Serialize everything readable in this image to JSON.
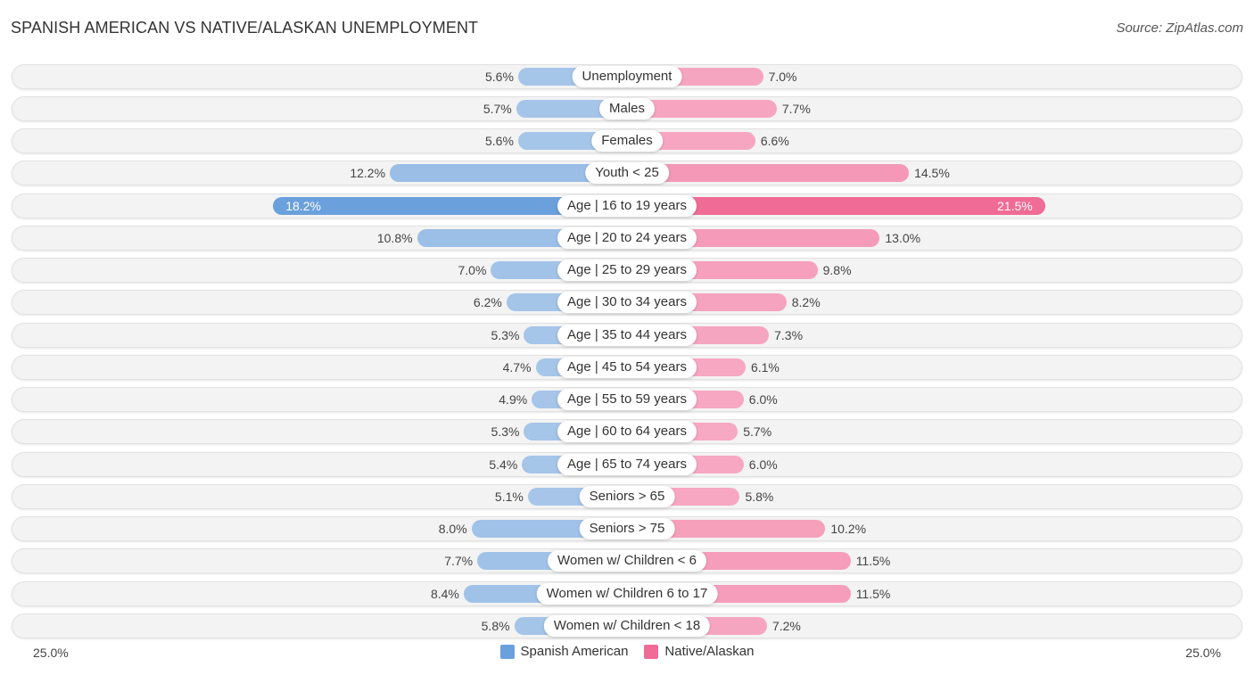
{
  "title": "SPANISH AMERICAN VS NATIVE/ALASKAN UNEMPLOYMENT",
  "source": "Source: ZipAtlas.com",
  "chart_data": {
    "type": "bar",
    "orientation": "horizontal-diverging",
    "title": "SPANISH AMERICAN VS NATIVE/ALASKAN UNEMPLOYMENT",
    "xlim": [
      0,
      25.0
    ],
    "axis_labels": {
      "left": "25.0%",
      "right": "25.0%"
    },
    "legend_position": "bottom-center",
    "categories": [
      "Unemployment",
      "Males",
      "Females",
      "Youth < 25",
      "Age | 16 to 19 years",
      "Age | 20 to 24 years",
      "Age | 25 to 29 years",
      "Age | 30 to 34 years",
      "Age | 35 to 44 years",
      "Age | 45 to 54 years",
      "Age | 55 to 59 years",
      "Age | 60 to 64 years",
      "Age | 65 to 74 years",
      "Seniors > 65",
      "Seniors > 75",
      "Women w/ Children < 6",
      "Women w/ Children 6 to 17",
      "Women w/ Children < 18"
    ],
    "series": [
      {
        "name": "Spanish American",
        "side": "left",
        "color": "#6aa0dc",
        "color_light": "#a7c6e9",
        "values": [
          5.6,
          5.7,
          5.6,
          12.2,
          18.2,
          10.8,
          7.0,
          6.2,
          5.3,
          4.7,
          4.9,
          5.3,
          5.4,
          5.1,
          8.0,
          7.7,
          8.4,
          5.8
        ],
        "labels": [
          "5.6%",
          "5.7%",
          "5.6%",
          "12.2%",
          "18.2%",
          "10.8%",
          "7.0%",
          "6.2%",
          "5.3%",
          "4.7%",
          "4.9%",
          "5.3%",
          "5.4%",
          "5.1%",
          "8.0%",
          "7.7%",
          "8.4%",
          "5.8%"
        ]
      },
      {
        "name": "Native/Alaskan",
        "side": "right",
        "color": "#f06b96",
        "color_light": "#f7aac4",
        "values": [
          7.0,
          7.7,
          6.6,
          14.5,
          21.5,
          13.0,
          9.8,
          8.2,
          7.3,
          6.1,
          6.0,
          5.7,
          6.0,
          5.8,
          10.2,
          11.5,
          11.5,
          7.2
        ],
        "labels": [
          "7.0%",
          "7.7%",
          "6.6%",
          "14.5%",
          "21.5%",
          "13.0%",
          "9.8%",
          "8.2%",
          "7.3%",
          "6.1%",
          "6.0%",
          "5.7%",
          "6.0%",
          "5.8%",
          "10.2%",
          "11.5%",
          "11.5%",
          "7.2%"
        ]
      }
    ]
  },
  "legend": [
    {
      "label": "Spanish American",
      "color": "#6aa0dc"
    },
    {
      "label": "Native/Alaskan",
      "color": "#f06b96"
    }
  ]
}
